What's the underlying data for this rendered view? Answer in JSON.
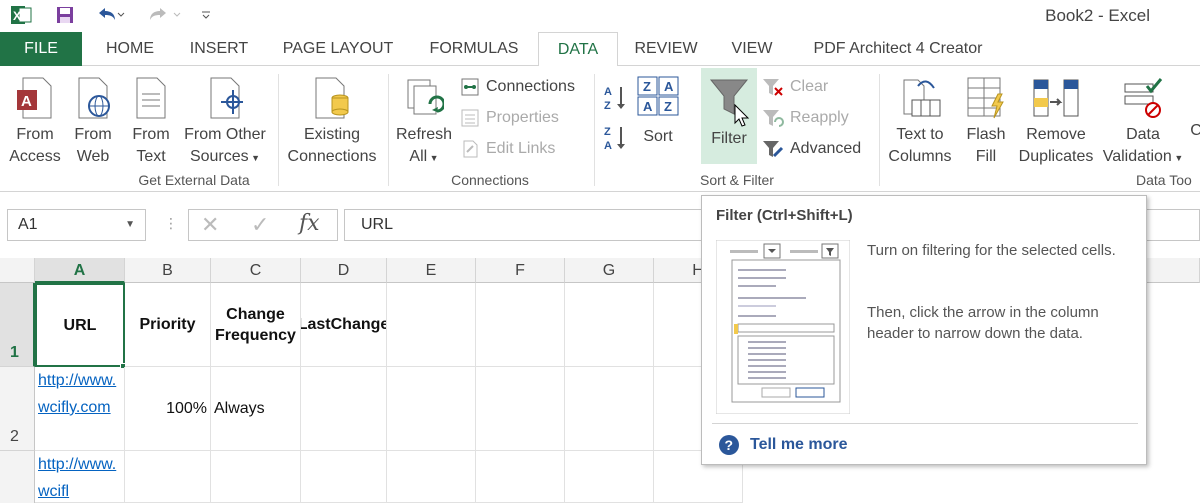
{
  "window": {
    "title": "Book2 - Excel"
  },
  "qat": {
    "excel_icon": "excel-logo-icon",
    "save_icon": "save-icon",
    "undo_icon": "undo-icon",
    "redo_icon": "redo-icon",
    "customize_icon": "customize-qat-icon"
  },
  "tabs": [
    {
      "label": "FILE"
    },
    {
      "label": "HOME"
    },
    {
      "label": "INSERT"
    },
    {
      "label": "PAGE LAYOUT"
    },
    {
      "label": "FORMULAS"
    },
    {
      "label": "DATA"
    },
    {
      "label": "REVIEW"
    },
    {
      "label": "VIEW"
    },
    {
      "label": "PDF Architect 4 Creator"
    }
  ],
  "ribbon": {
    "get_external": {
      "label": "Get External Data",
      "from_access": [
        "From",
        "Access"
      ],
      "from_web": [
        "From",
        "Web"
      ],
      "from_text": [
        "From",
        "Text"
      ],
      "from_other": [
        "From Other",
        "Sources"
      ],
      "existing": [
        "Existing",
        "Connections"
      ]
    },
    "connections": {
      "label": "Connections",
      "refresh": [
        "Refresh",
        "All"
      ],
      "connections": "Connections",
      "properties": "Properties",
      "edit_links": "Edit Links"
    },
    "sort_filter": {
      "label": "Sort & Filter",
      "sort": "Sort",
      "filter": "Filter",
      "clear": "Clear",
      "reapply": "Reapply",
      "advanced": "Advanced"
    },
    "data_tools": {
      "label": "Data Too",
      "text_to_columns": [
        "Text to",
        "Columns"
      ],
      "flash_fill": [
        "Flash",
        "Fill"
      ],
      "remove_dup": [
        "Remove",
        "Duplicates"
      ],
      "data_validation": [
        "Data",
        "Validation"
      ],
      "partial": "C"
    }
  },
  "formula_bar": {
    "name_box": "A1",
    "formula": "URL",
    "fx": "fx"
  },
  "grid": {
    "columns": [
      "A",
      "B",
      "C",
      "D",
      "E",
      "F",
      "G",
      "H"
    ],
    "rows": [
      "1",
      "2"
    ],
    "headers": {
      "a1": "URL",
      "b1": "Priority",
      "c1": "Change Frequency",
      "d1": "LastChange"
    },
    "row2": {
      "a": "http://www.wcifly.com",
      "b": "100%",
      "c": "Always"
    },
    "row3": {
      "a": "http://www.wcifl"
    }
  },
  "tooltip": {
    "title": "Filter (Ctrl+Shift+L)",
    "line1": "Turn on filtering for the selected cells.",
    "line2": "Then, click the arrow in the column header to narrow down the data.",
    "more": "Tell me more",
    "help_icon": "help-icon"
  },
  "colors": {
    "accent": "#217346",
    "link": "#0563c1",
    "help": "#2b579a"
  }
}
